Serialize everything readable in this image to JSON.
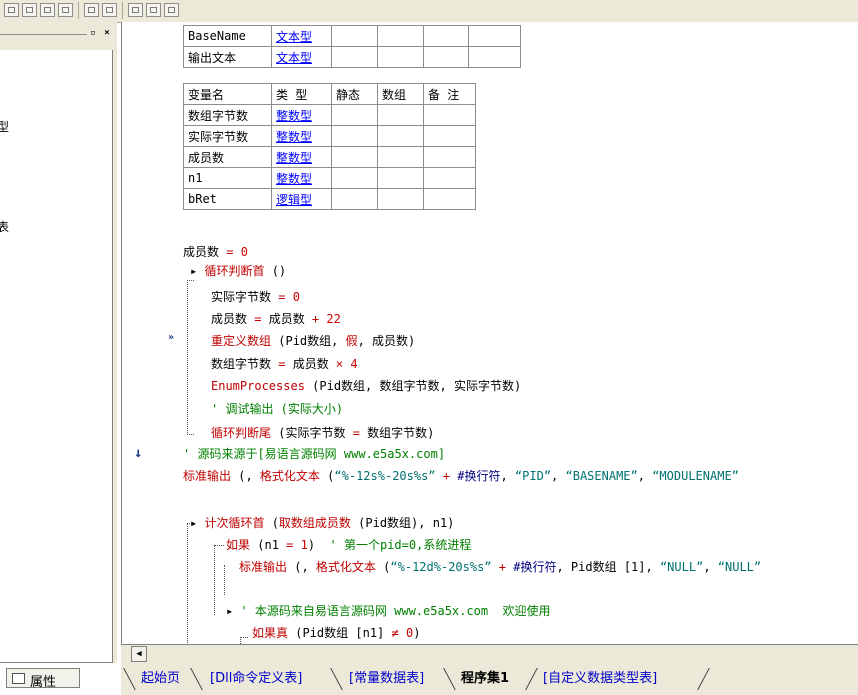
{
  "left_panel": {
    "tree_text_1": "型",
    "tree_text_2": "表",
    "min_button": "▫",
    "close_button": "×",
    "properties_label": "属性"
  },
  "table1": {
    "rows": [
      {
        "name": "BaseName",
        "type": "文本型"
      },
      {
        "name": "输出文本",
        "type": "文本型"
      }
    ]
  },
  "table2": {
    "headers": [
      "变量名",
      "类 型",
      "静态",
      "数组",
      "备 注"
    ],
    "rows": [
      {
        "name": "数组字节数",
        "type": "整数型"
      },
      {
        "name": "实际字节数",
        "type": "整数型"
      },
      {
        "name": "成员数",
        "type": "整数型"
      },
      {
        "name": "n1",
        "type": "整数型"
      },
      {
        "name": "bRet",
        "type": "逻辑型"
      }
    ]
  },
  "code": {
    "l1_a": "成员数 ",
    "l1_b": "= ",
    "l1_c": "0",
    "l2_a": "循环判断首",
    "l2_b": " ()",
    "l3_a": "实际字节数 ",
    "l3_b": "= ",
    "l3_c": "0",
    "l4_a": "成员数 ",
    "l4_b": "= ",
    "l4_c": "成员数 ",
    "l4_d": "+ ",
    "l4_e": "22",
    "l5_a": "重定义数组",
    "l5_b": " (Pid数组, ",
    "l5_c": "假",
    "l5_d": ", 成员数)",
    "l6_a": "数组字节数 ",
    "l6_b": "= ",
    "l6_c": "成员数 ",
    "l6_d": "× ",
    "l6_e": "4",
    "l7_a": "EnumProcesses",
    "l7_b": " (Pid数组, 数组字节数, 实际字节数)",
    "l8": "' 调试输出 (实际大小)",
    "l9_a": "循环判断尾",
    "l9_b": " (实际字节数 ",
    "l9_c": "= ",
    "l9_d": "数组字节数)",
    "l10": "' 源码来源于[易语言源码网 www.e5a5x.com]",
    "l11_a": "标准输出",
    "l11_b": " (, ",
    "l11_c": "格式化文本",
    "l11_d": " (",
    "l11_e": "“%-12s%-20s%s”",
    "l11_f": " + ",
    "l11_g": "#换行符",
    "l11_h": ", ",
    "l11_i": "“PID”",
    "l11_j": ", ",
    "l11_k": "“BASENAME”",
    "l11_l": ", ",
    "l11_m": "“MODULENAME”",
    "l12_a": "计次循环首",
    "l12_b": " (",
    "l12_c": "取数组成员数",
    "l12_d": " (Pid数组), n1)",
    "l13_a": "如果",
    "l13_b": " (n1 ",
    "l13_c": "= ",
    "l13_d": "1",
    "l13_e": ")  ",
    "l13_f": "' 第一个pid=0,系统进程",
    "l14_a": "标准输出",
    "l14_b": " (, ",
    "l14_c": "格式化文本",
    "l14_d": " (",
    "l14_e": "“%-12d%-20s%s”",
    "l14_f": " + ",
    "l14_g": "#换行符",
    "l14_h": ", Pid数组 [1], ",
    "l14_i": "“NULL”",
    "l14_j": ", ",
    "l14_k": "“NULL”",
    "l15": "' 本源码来自易语言源码网 www.e5a5x.com  欢迎使用",
    "l16_a": "如果真",
    "l16_b": " (Pid数组 [n1] ",
    "l16_c": "≠ ",
    "l16_d": "0",
    "l16_e": ")"
  },
  "tabs": {
    "t1": "起始页",
    "t2": "[Dll命令定义表]",
    "t3": "[常量数据表]",
    "t4": "程序集1",
    "t5": "[自定义数据类型表]"
  },
  "colors": {
    "keyword": "#c00000",
    "comment": "#008000",
    "string": "#007070",
    "type_link": "#0000ff"
  }
}
